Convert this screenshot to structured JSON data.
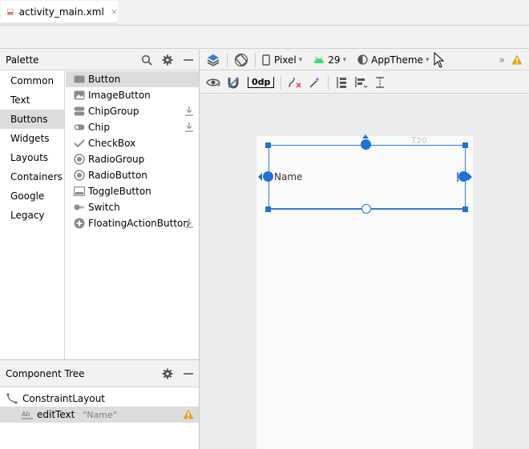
{
  "tab": {
    "label": "activity_main.xml",
    "close": "×"
  },
  "palette": {
    "title": "Palette",
    "categories": [
      "Common",
      "Text",
      "Buttons",
      "Widgets",
      "Layouts",
      "Containers",
      "Google",
      "Legacy"
    ],
    "selected_category": "Buttons",
    "items": [
      {
        "label": "Button",
        "icon": "button-icon"
      },
      {
        "label": "ImageButton",
        "icon": "image-button-icon"
      },
      {
        "label": "ChipGroup",
        "icon": "chip-group-icon",
        "download": true
      },
      {
        "label": "Chip",
        "icon": "chip-icon",
        "download": true
      },
      {
        "label": "CheckBox",
        "icon": "checkbox-icon"
      },
      {
        "label": "RadioGroup",
        "icon": "radio-group-icon"
      },
      {
        "label": "RadioButton",
        "icon": "radio-button-icon"
      },
      {
        "label": "ToggleButton",
        "icon": "toggle-button-icon"
      },
      {
        "label": "Switch",
        "icon": "switch-icon"
      },
      {
        "label": "FloatingActionButton",
        "icon": "fab-icon",
        "download": true
      }
    ]
  },
  "component_tree": {
    "title": "Component Tree",
    "rows": [
      {
        "label": "ConstraintLayout",
        "icon": "constraint-layout-icon"
      },
      {
        "label": "editText",
        "hint": "\"Name\"",
        "icon": "edit-text-icon",
        "warning": true
      }
    ]
  },
  "toolbar": {
    "device": "Pixel",
    "api": "29",
    "theme": "AppTheme",
    "margin": "0dp",
    "overflow": "»"
  },
  "canvas": {
    "edit_text_value": "Name",
    "margin_hint": "20"
  },
  "colors": {
    "selection": "#2d7ed8",
    "android_green": "#3ddc84",
    "warning": "#e8a317"
  }
}
